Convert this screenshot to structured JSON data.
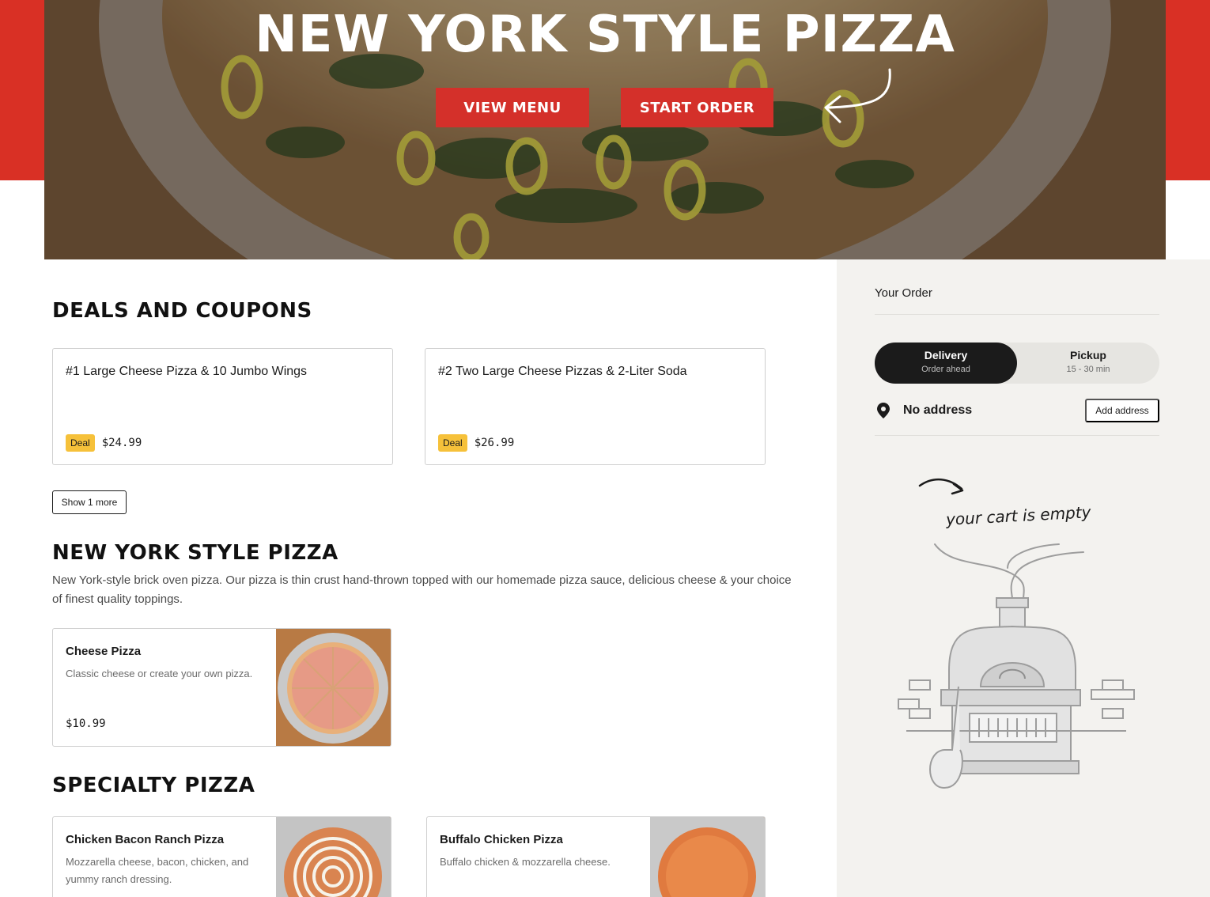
{
  "hero": {
    "title": "NEW YORK STYLE PIZZA",
    "view_menu": "VIEW MENU",
    "start_order": "START ORDER"
  },
  "deals": {
    "title": "DEALS AND COUPONS",
    "items": [
      {
        "name": "#1 Large Cheese Pizza & 10 Jumbo Wings",
        "badge": "Deal",
        "price": "$24.99"
      },
      {
        "name": "#2 Two Large Cheese Pizzas & 2-Liter Soda",
        "badge": "Deal",
        "price": "$26.99"
      }
    ],
    "show_more": "Show 1 more"
  },
  "ny_section": {
    "title": "NEW YORK STYLE PIZZA",
    "description": "New York-style brick oven pizza. Our pizza is thin crust hand-thrown topped with our homemade pizza sauce, delicious cheese & your choice of finest quality toppings.",
    "items": [
      {
        "name": "Cheese Pizza",
        "description": "Classic cheese or create your own pizza.",
        "price": "$10.99"
      }
    ]
  },
  "specialty_section": {
    "title": "SPECIALTY PIZZA",
    "items": [
      {
        "name": "Chicken Bacon Ranch Pizza",
        "description": "Mozzarella cheese, bacon, chicken, and yummy ranch dressing."
      },
      {
        "name": "Buffalo Chicken Pizza",
        "description": "Buffalo chicken & mozzarella cheese."
      }
    ]
  },
  "sidebar": {
    "title": "Your Order",
    "delivery": {
      "label": "Delivery",
      "sub": "Order ahead"
    },
    "pickup": {
      "label": "Pickup",
      "sub": "15 - 30 min"
    },
    "address": "No address",
    "add_address": "Add address",
    "empty_cart": "your cart is empty"
  },
  "colors": {
    "brand_red": "#d93025",
    "deal_badge": "#f6c13a",
    "sidebar_bg": "#f3f2ef",
    "toggle_active": "#1b1b1b"
  },
  "icons": [
    "location-pin-icon",
    "hand-drawn-arrow-icon",
    "pizza-oven-illustration"
  ]
}
